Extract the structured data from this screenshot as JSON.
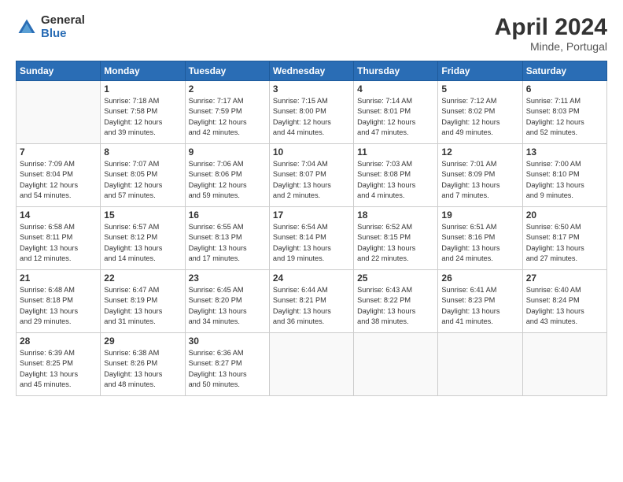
{
  "header": {
    "logo_general": "General",
    "logo_blue": "Blue",
    "month_year": "April 2024",
    "location": "Minde, Portugal"
  },
  "days_of_week": [
    "Sunday",
    "Monday",
    "Tuesday",
    "Wednesday",
    "Thursday",
    "Friday",
    "Saturday"
  ],
  "weeks": [
    [
      {
        "day": "",
        "info": ""
      },
      {
        "day": "1",
        "info": "Sunrise: 7:18 AM\nSunset: 7:58 PM\nDaylight: 12 hours\nand 39 minutes."
      },
      {
        "day": "2",
        "info": "Sunrise: 7:17 AM\nSunset: 7:59 PM\nDaylight: 12 hours\nand 42 minutes."
      },
      {
        "day": "3",
        "info": "Sunrise: 7:15 AM\nSunset: 8:00 PM\nDaylight: 12 hours\nand 44 minutes."
      },
      {
        "day": "4",
        "info": "Sunrise: 7:14 AM\nSunset: 8:01 PM\nDaylight: 12 hours\nand 47 minutes."
      },
      {
        "day": "5",
        "info": "Sunrise: 7:12 AM\nSunset: 8:02 PM\nDaylight: 12 hours\nand 49 minutes."
      },
      {
        "day": "6",
        "info": "Sunrise: 7:11 AM\nSunset: 8:03 PM\nDaylight: 12 hours\nand 52 minutes."
      }
    ],
    [
      {
        "day": "7",
        "info": "Sunrise: 7:09 AM\nSunset: 8:04 PM\nDaylight: 12 hours\nand 54 minutes."
      },
      {
        "day": "8",
        "info": "Sunrise: 7:07 AM\nSunset: 8:05 PM\nDaylight: 12 hours\nand 57 minutes."
      },
      {
        "day": "9",
        "info": "Sunrise: 7:06 AM\nSunset: 8:06 PM\nDaylight: 12 hours\nand 59 minutes."
      },
      {
        "day": "10",
        "info": "Sunrise: 7:04 AM\nSunset: 8:07 PM\nDaylight: 13 hours\nand 2 minutes."
      },
      {
        "day": "11",
        "info": "Sunrise: 7:03 AM\nSunset: 8:08 PM\nDaylight: 13 hours\nand 4 minutes."
      },
      {
        "day": "12",
        "info": "Sunrise: 7:01 AM\nSunset: 8:09 PM\nDaylight: 13 hours\nand 7 minutes."
      },
      {
        "day": "13",
        "info": "Sunrise: 7:00 AM\nSunset: 8:10 PM\nDaylight: 13 hours\nand 9 minutes."
      }
    ],
    [
      {
        "day": "14",
        "info": "Sunrise: 6:58 AM\nSunset: 8:11 PM\nDaylight: 13 hours\nand 12 minutes."
      },
      {
        "day": "15",
        "info": "Sunrise: 6:57 AM\nSunset: 8:12 PM\nDaylight: 13 hours\nand 14 minutes."
      },
      {
        "day": "16",
        "info": "Sunrise: 6:55 AM\nSunset: 8:13 PM\nDaylight: 13 hours\nand 17 minutes."
      },
      {
        "day": "17",
        "info": "Sunrise: 6:54 AM\nSunset: 8:14 PM\nDaylight: 13 hours\nand 19 minutes."
      },
      {
        "day": "18",
        "info": "Sunrise: 6:52 AM\nSunset: 8:15 PM\nDaylight: 13 hours\nand 22 minutes."
      },
      {
        "day": "19",
        "info": "Sunrise: 6:51 AM\nSunset: 8:16 PM\nDaylight: 13 hours\nand 24 minutes."
      },
      {
        "day": "20",
        "info": "Sunrise: 6:50 AM\nSunset: 8:17 PM\nDaylight: 13 hours\nand 27 minutes."
      }
    ],
    [
      {
        "day": "21",
        "info": "Sunrise: 6:48 AM\nSunset: 8:18 PM\nDaylight: 13 hours\nand 29 minutes."
      },
      {
        "day": "22",
        "info": "Sunrise: 6:47 AM\nSunset: 8:19 PM\nDaylight: 13 hours\nand 31 minutes."
      },
      {
        "day": "23",
        "info": "Sunrise: 6:45 AM\nSunset: 8:20 PM\nDaylight: 13 hours\nand 34 minutes."
      },
      {
        "day": "24",
        "info": "Sunrise: 6:44 AM\nSunset: 8:21 PM\nDaylight: 13 hours\nand 36 minutes."
      },
      {
        "day": "25",
        "info": "Sunrise: 6:43 AM\nSunset: 8:22 PM\nDaylight: 13 hours\nand 38 minutes."
      },
      {
        "day": "26",
        "info": "Sunrise: 6:41 AM\nSunset: 8:23 PM\nDaylight: 13 hours\nand 41 minutes."
      },
      {
        "day": "27",
        "info": "Sunrise: 6:40 AM\nSunset: 8:24 PM\nDaylight: 13 hours\nand 43 minutes."
      }
    ],
    [
      {
        "day": "28",
        "info": "Sunrise: 6:39 AM\nSunset: 8:25 PM\nDaylight: 13 hours\nand 45 minutes."
      },
      {
        "day": "29",
        "info": "Sunrise: 6:38 AM\nSunset: 8:26 PM\nDaylight: 13 hours\nand 48 minutes."
      },
      {
        "day": "30",
        "info": "Sunrise: 6:36 AM\nSunset: 8:27 PM\nDaylight: 13 hours\nand 50 minutes."
      },
      {
        "day": "",
        "info": ""
      },
      {
        "day": "",
        "info": ""
      },
      {
        "day": "",
        "info": ""
      },
      {
        "day": "",
        "info": ""
      }
    ]
  ]
}
